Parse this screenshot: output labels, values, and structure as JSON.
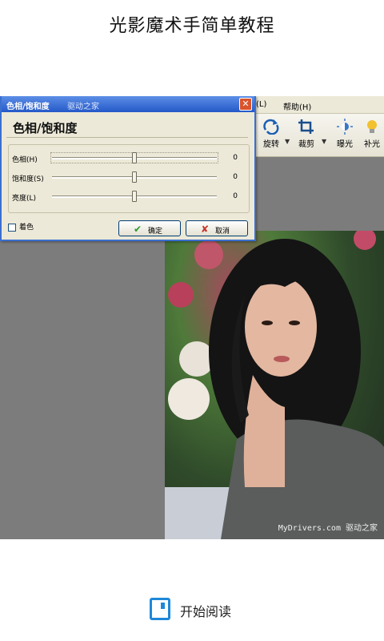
{
  "page": {
    "title": "光影魔术手简单教程"
  },
  "app": {
    "menubar": {
      "item1": "(L)",
      "item2": "帮助(H)"
    },
    "toolbar": {
      "rotate_label": "旋转",
      "crop_label": "裁剪",
      "exposure_label": "曝光",
      "fill_light_label": "补光"
    }
  },
  "dialog": {
    "title": "色相/饱和度",
    "title_site": "驱动之家",
    "heading": "色相/饱和度",
    "sliders": [
      {
        "label": "色相(H)",
        "value": "0",
        "level": 0.5
      },
      {
        "label": "饱和度(S)",
        "value": "0",
        "level": 0.5
      },
      {
        "label": "亮度(L)",
        "value": "0",
        "level": 0.5
      }
    ],
    "colorize_label": "着色",
    "ok_label": "确定",
    "cancel_label": "取消"
  },
  "photo": {
    "watermark": "MyDrivers.com 驱动之家"
  },
  "cta": {
    "label": "开始阅读"
  },
  "colors": {
    "accent": "#1e88d8",
    "dialog_title": "#2459c8",
    "workspace": "#7c7c7c"
  }
}
